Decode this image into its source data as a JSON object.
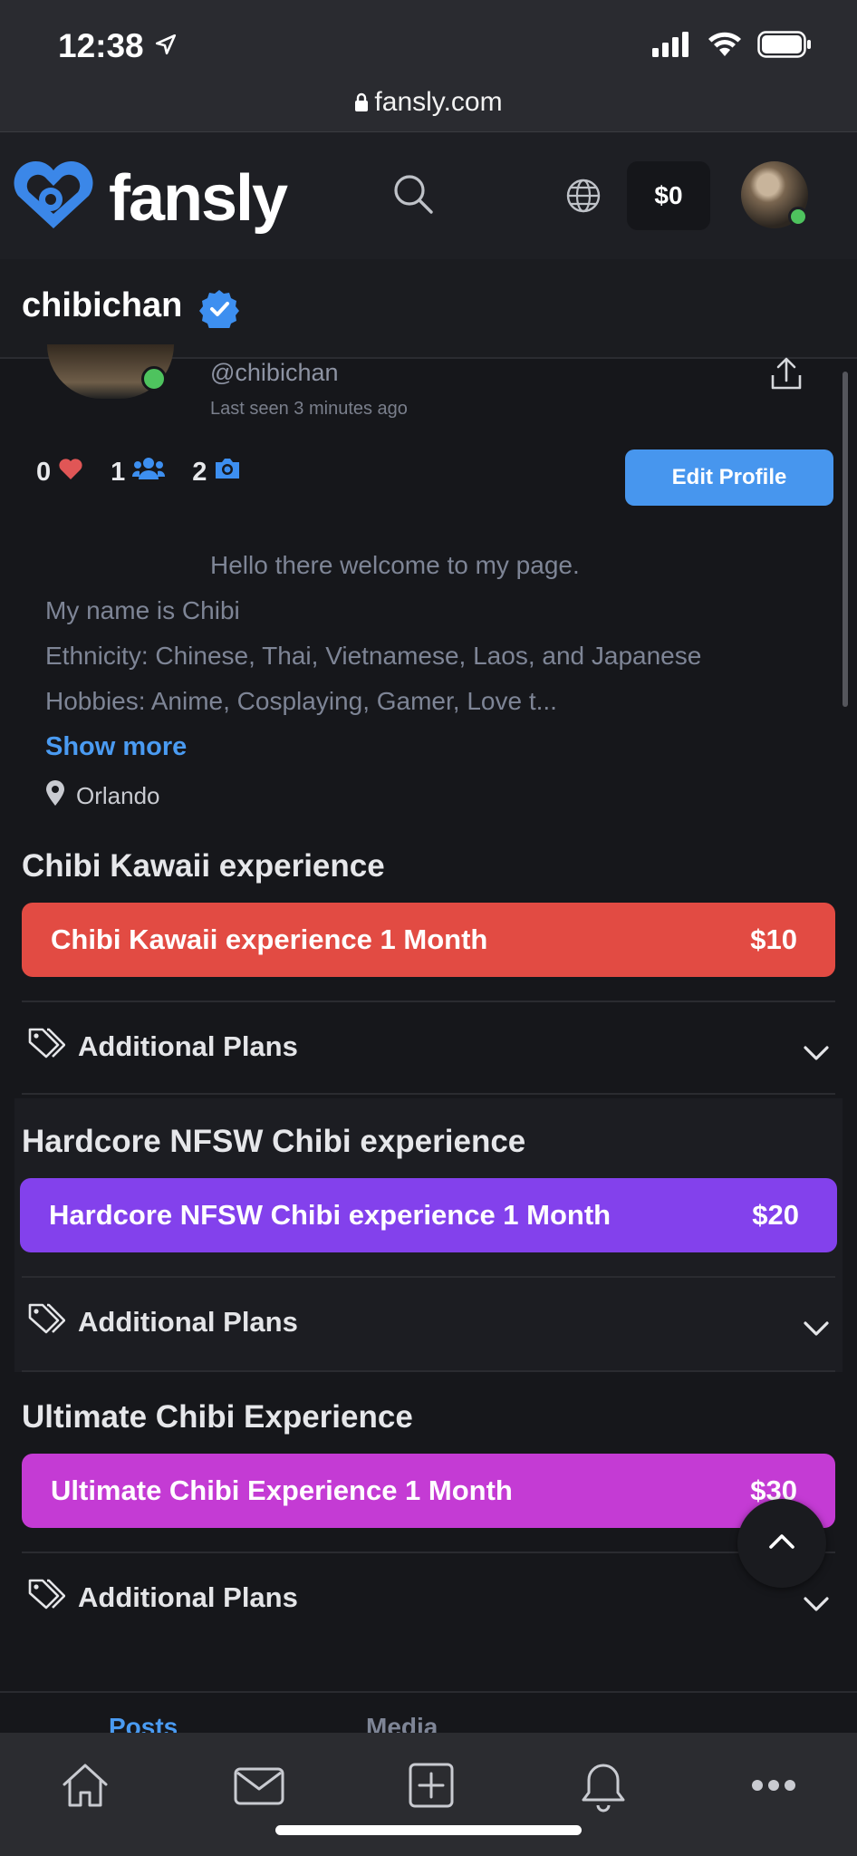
{
  "status_bar": {
    "time": "12:38",
    "url": "fansly.com"
  },
  "header": {
    "brand": "fansly",
    "wallet": "$0"
  },
  "profile": {
    "name": "chibichan",
    "handle": "@chibichan",
    "last_seen": "Last seen 3 minutes ago",
    "stats": {
      "likes": "0",
      "followers": "1",
      "media": "2"
    },
    "edit_label": "Edit Profile",
    "bio": [
      "Hello there welcome to my page.",
      "My name is Chibi",
      "Ethnicity: Chinese, Thai, Vietnamese, Laos, and Japanese",
      "Hobbies: Anime, Cosplaying, Gamer, Love t..."
    ],
    "show_more": "Show more",
    "location": "Orlando"
  },
  "plans": [
    {
      "title": "Chibi Kawaii experience",
      "bar_label": "Chibi Kawaii experience 1 Month",
      "price": "$10",
      "color": "#e24b43",
      "additional": "Additional Plans"
    },
    {
      "title": "Hardcore NFSW Chibi experience",
      "bar_label": "Hardcore NFSW Chibi experience 1 Month",
      "price": "$20",
      "color": "#8341ec",
      "additional": "Additional Plans"
    },
    {
      "title": "Ultimate Chibi Experience",
      "bar_label": "Ultimate Chibi Experience 1 Month",
      "price": "$30",
      "color": "#c43bd4",
      "additional": "Additional Plans"
    }
  ],
  "tabs": [
    "Posts",
    "Media"
  ],
  "bottom_nav": [
    "home-icon",
    "messages-icon",
    "create-post-icon",
    "notifications-icon",
    "more-icon"
  ],
  "colors": {
    "accent": "#4a9bf2",
    "online": "#4ec35e",
    "background": "#16171b"
  }
}
